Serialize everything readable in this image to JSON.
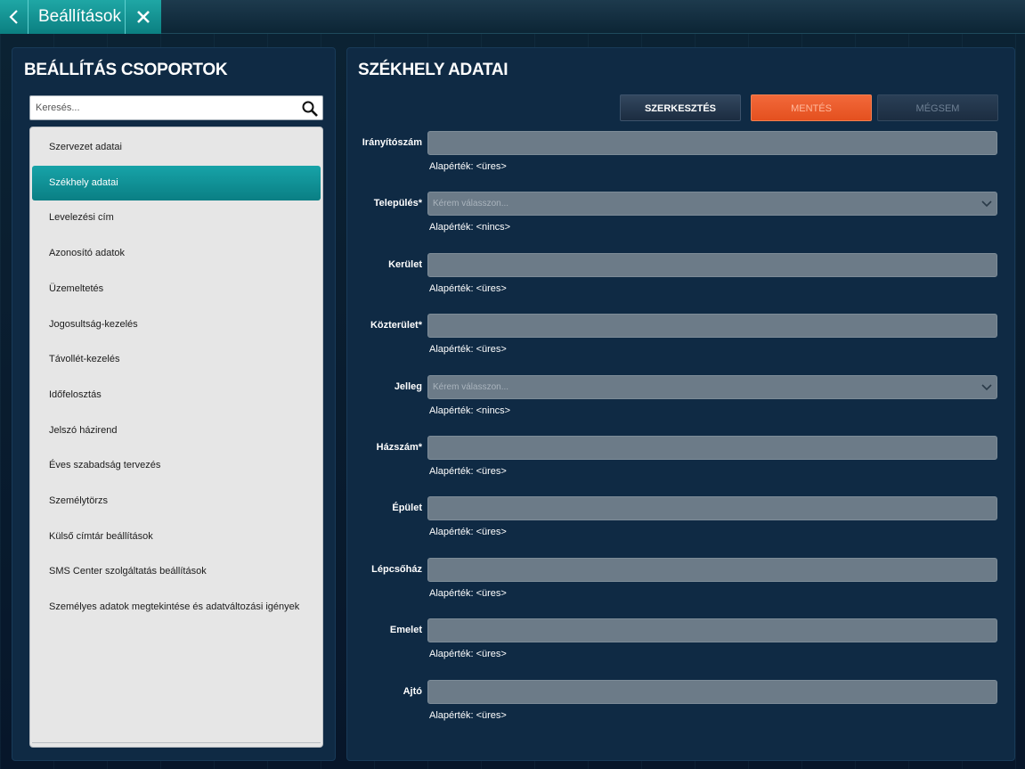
{
  "topbar": {
    "title": "Beállítások"
  },
  "left": {
    "title": "BEÁLLÍTÁS CSOPORTOK",
    "search_placeholder": "Keresés...",
    "items": [
      {
        "label": "Szervezet adatai",
        "active": false
      },
      {
        "label": "Székhely adatai",
        "active": true
      },
      {
        "label": "Levelezési cím",
        "active": false
      },
      {
        "label": "Azonosító adatok",
        "active": false
      },
      {
        "label": "Üzemeltetés",
        "active": false
      },
      {
        "label": "Jogosultság-kezelés",
        "active": false
      },
      {
        "label": "Távollét-kezelés",
        "active": false
      },
      {
        "label": "Időfelosztás",
        "active": false
      },
      {
        "label": "Jelszó házirend",
        "active": false
      },
      {
        "label": "Éves szabadság tervezés",
        "active": false
      },
      {
        "label": "Személytörzs",
        "active": false
      },
      {
        "label": "Külső címtár beállítások",
        "active": false
      },
      {
        "label": "SMS Center szolgáltatás beállítások",
        "active": false
      },
      {
        "label": "Személyes adatok megtekintése és adatváltozási igények",
        "active": false
      }
    ]
  },
  "right": {
    "title": "SZÉKHELY ADATAI",
    "buttons": {
      "edit": "SZERKESZTÉS",
      "save": "MENTÉS",
      "cancel": "MÉGSEM"
    },
    "fields": [
      {
        "label": "Irányítószám",
        "type": "text",
        "value": "",
        "default": "Alapérték: <üres>"
      },
      {
        "label": "Település*",
        "type": "select",
        "placeholder": "Kérem válasszon...",
        "default": "Alapérték: <nincs>"
      },
      {
        "label": "Kerület",
        "type": "text",
        "value": "",
        "default": "Alapérték: <üres>"
      },
      {
        "label": "Közterület*",
        "type": "text",
        "value": "",
        "default": "Alapérték: <üres>"
      },
      {
        "label": "Jelleg",
        "type": "select",
        "placeholder": "Kérem válasszon...",
        "default": "Alapérték: <nincs>"
      },
      {
        "label": "Házszám*",
        "type": "text",
        "value": "",
        "default": "Alapérték: <üres>"
      },
      {
        "label": "Épület",
        "type": "text",
        "value": "",
        "default": "Alapérték: <üres>"
      },
      {
        "label": "Lépcsőház",
        "type": "text",
        "value": "",
        "default": "Alapérték: <üres>"
      },
      {
        "label": "Emelet",
        "type": "text",
        "value": "",
        "default": "Alapérték: <üres>"
      },
      {
        "label": "Ajtó",
        "type": "text",
        "value": "",
        "default": "Alapérték: <üres>"
      }
    ]
  },
  "colors": {
    "accent": "#0b8f93",
    "save": "#e95b2b",
    "panel": "#0f2a44",
    "field": "#6c7b88"
  }
}
